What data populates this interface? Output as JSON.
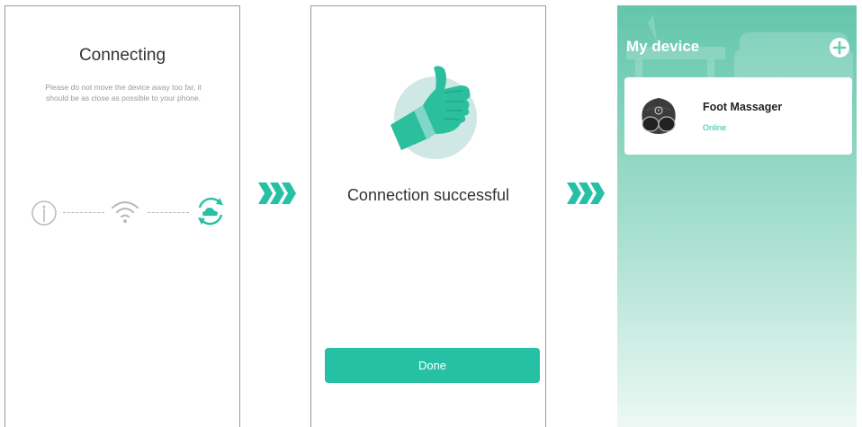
{
  "colors": {
    "accent": "#26c1a4",
    "thumb": "#2bbf9e",
    "thumb_circle": "#cfe8e6",
    "muted_icon": "#bdbdbd",
    "gradient_top": "#62c6ab",
    "gradient_bottom": "#edf8f5"
  },
  "connecting": {
    "title": "Connecting",
    "description": "Please do not move the device away too far, it should be as close as possible to your phone.",
    "steps": [
      "device-icon",
      "wifi-icon",
      "cloud-sync-icon"
    ]
  },
  "success": {
    "message": "Connection successful",
    "done_label": "Done"
  },
  "my_device": {
    "title": "My device",
    "add_icon": "plus-icon",
    "devices": [
      {
        "name": "Foot Massager",
        "status": "Online",
        "icon": "foot-massager-icon"
      }
    ]
  }
}
